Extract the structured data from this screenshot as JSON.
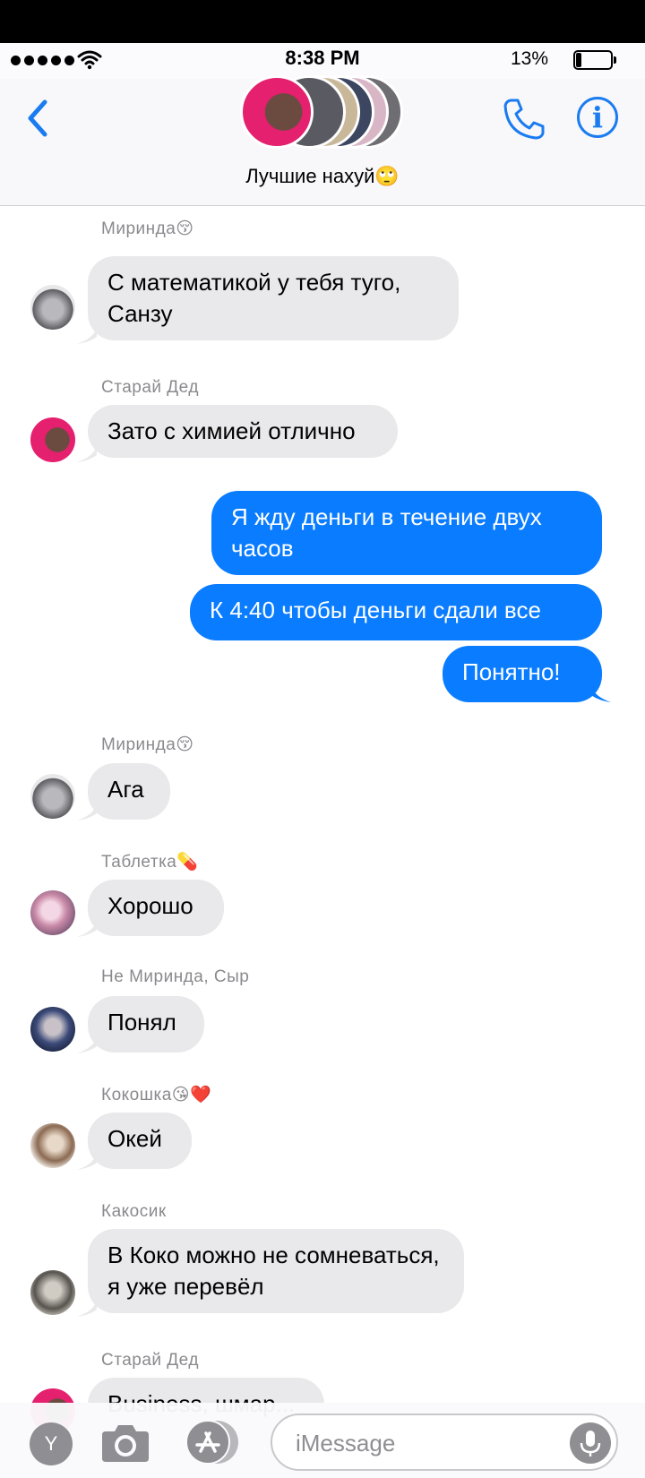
{
  "status": {
    "time": "8:38 PM",
    "battery": "13%"
  },
  "header": {
    "group_name": "Лучшие нахуй🙄"
  },
  "messages": [
    {
      "sender": "Миринда😚",
      "text": "С математикой у тебя туго, Санзу"
    },
    {
      "sender": "Старай Дед",
      "text": "Зато с химией отлично"
    },
    {
      "text": "Я жду деньги в течение двух часов"
    },
    {
      "text": "К 4:40 чтобы деньги сдали все"
    },
    {
      "text": "Понятно!"
    },
    {
      "sender": "Миринда😚",
      "text": "Ага"
    },
    {
      "sender": "Таблетка💊",
      "text": "Хорошо"
    },
    {
      "sender": "Не Миринда, Сыр",
      "text": "Понял"
    },
    {
      "sender": "Кокошка😘❤️",
      "text": "Окей"
    },
    {
      "sender": "Какосик",
      "text": "В Коко можно не сомневаться, я уже перевёл"
    },
    {
      "sender": "Старай Дед",
      "text": "Business, шмар..."
    }
  ],
  "input": {
    "y_button": "Y",
    "placeholder": "iMessage"
  },
  "colors": {
    "accent": "#1a7cf0",
    "outgoing_bubble": "#0a7cff",
    "incoming_bubble": "#e9e9eb"
  },
  "icons": [
    "signal-dots-icon",
    "wifi-icon",
    "battery-icon",
    "back-chevron-icon",
    "phone-icon",
    "info-icon",
    "camera-icon",
    "app-store-icon",
    "microphone-icon"
  ]
}
